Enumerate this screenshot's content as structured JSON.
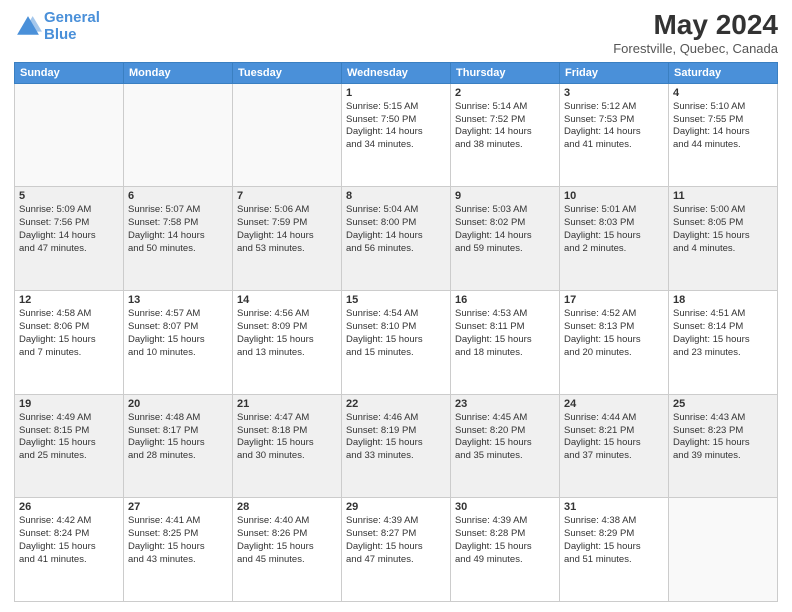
{
  "header": {
    "logo_line1": "General",
    "logo_line2": "Blue",
    "main_title": "May 2024",
    "subtitle": "Forestville, Quebec, Canada"
  },
  "days": [
    "Sunday",
    "Monday",
    "Tuesday",
    "Wednesday",
    "Thursday",
    "Friday",
    "Saturday"
  ],
  "weeks": [
    [
      {
        "date": "",
        "info": ""
      },
      {
        "date": "",
        "info": ""
      },
      {
        "date": "",
        "info": ""
      },
      {
        "date": "1",
        "info": "Sunrise: 5:15 AM\nSunset: 7:50 PM\nDaylight: 14 hours\nand 34 minutes."
      },
      {
        "date": "2",
        "info": "Sunrise: 5:14 AM\nSunset: 7:52 PM\nDaylight: 14 hours\nand 38 minutes."
      },
      {
        "date": "3",
        "info": "Sunrise: 5:12 AM\nSunset: 7:53 PM\nDaylight: 14 hours\nand 41 minutes."
      },
      {
        "date": "4",
        "info": "Sunrise: 5:10 AM\nSunset: 7:55 PM\nDaylight: 14 hours\nand 44 minutes."
      }
    ],
    [
      {
        "date": "5",
        "info": "Sunrise: 5:09 AM\nSunset: 7:56 PM\nDaylight: 14 hours\nand 47 minutes."
      },
      {
        "date": "6",
        "info": "Sunrise: 5:07 AM\nSunset: 7:58 PM\nDaylight: 14 hours\nand 50 minutes."
      },
      {
        "date": "7",
        "info": "Sunrise: 5:06 AM\nSunset: 7:59 PM\nDaylight: 14 hours\nand 53 minutes."
      },
      {
        "date": "8",
        "info": "Sunrise: 5:04 AM\nSunset: 8:00 PM\nDaylight: 14 hours\nand 56 minutes."
      },
      {
        "date": "9",
        "info": "Sunrise: 5:03 AM\nSunset: 8:02 PM\nDaylight: 14 hours\nand 59 minutes."
      },
      {
        "date": "10",
        "info": "Sunrise: 5:01 AM\nSunset: 8:03 PM\nDaylight: 15 hours\nand 2 minutes."
      },
      {
        "date": "11",
        "info": "Sunrise: 5:00 AM\nSunset: 8:05 PM\nDaylight: 15 hours\nand 4 minutes."
      }
    ],
    [
      {
        "date": "12",
        "info": "Sunrise: 4:58 AM\nSunset: 8:06 PM\nDaylight: 15 hours\nand 7 minutes."
      },
      {
        "date": "13",
        "info": "Sunrise: 4:57 AM\nSunset: 8:07 PM\nDaylight: 15 hours\nand 10 minutes."
      },
      {
        "date": "14",
        "info": "Sunrise: 4:56 AM\nSunset: 8:09 PM\nDaylight: 15 hours\nand 13 minutes."
      },
      {
        "date": "15",
        "info": "Sunrise: 4:54 AM\nSunset: 8:10 PM\nDaylight: 15 hours\nand 15 minutes."
      },
      {
        "date": "16",
        "info": "Sunrise: 4:53 AM\nSunset: 8:11 PM\nDaylight: 15 hours\nand 18 minutes."
      },
      {
        "date": "17",
        "info": "Sunrise: 4:52 AM\nSunset: 8:13 PM\nDaylight: 15 hours\nand 20 minutes."
      },
      {
        "date": "18",
        "info": "Sunrise: 4:51 AM\nSunset: 8:14 PM\nDaylight: 15 hours\nand 23 minutes."
      }
    ],
    [
      {
        "date": "19",
        "info": "Sunrise: 4:49 AM\nSunset: 8:15 PM\nDaylight: 15 hours\nand 25 minutes."
      },
      {
        "date": "20",
        "info": "Sunrise: 4:48 AM\nSunset: 8:17 PM\nDaylight: 15 hours\nand 28 minutes."
      },
      {
        "date": "21",
        "info": "Sunrise: 4:47 AM\nSunset: 8:18 PM\nDaylight: 15 hours\nand 30 minutes."
      },
      {
        "date": "22",
        "info": "Sunrise: 4:46 AM\nSunset: 8:19 PM\nDaylight: 15 hours\nand 33 minutes."
      },
      {
        "date": "23",
        "info": "Sunrise: 4:45 AM\nSunset: 8:20 PM\nDaylight: 15 hours\nand 35 minutes."
      },
      {
        "date": "24",
        "info": "Sunrise: 4:44 AM\nSunset: 8:21 PM\nDaylight: 15 hours\nand 37 minutes."
      },
      {
        "date": "25",
        "info": "Sunrise: 4:43 AM\nSunset: 8:23 PM\nDaylight: 15 hours\nand 39 minutes."
      }
    ],
    [
      {
        "date": "26",
        "info": "Sunrise: 4:42 AM\nSunset: 8:24 PM\nDaylight: 15 hours\nand 41 minutes."
      },
      {
        "date": "27",
        "info": "Sunrise: 4:41 AM\nSunset: 8:25 PM\nDaylight: 15 hours\nand 43 minutes."
      },
      {
        "date": "28",
        "info": "Sunrise: 4:40 AM\nSunset: 8:26 PM\nDaylight: 15 hours\nand 45 minutes."
      },
      {
        "date": "29",
        "info": "Sunrise: 4:39 AM\nSunset: 8:27 PM\nDaylight: 15 hours\nand 47 minutes."
      },
      {
        "date": "30",
        "info": "Sunrise: 4:39 AM\nSunset: 8:28 PM\nDaylight: 15 hours\nand 49 minutes."
      },
      {
        "date": "31",
        "info": "Sunrise: 4:38 AM\nSunset: 8:29 PM\nDaylight: 15 hours\nand 51 minutes."
      },
      {
        "date": "",
        "info": ""
      }
    ]
  ]
}
